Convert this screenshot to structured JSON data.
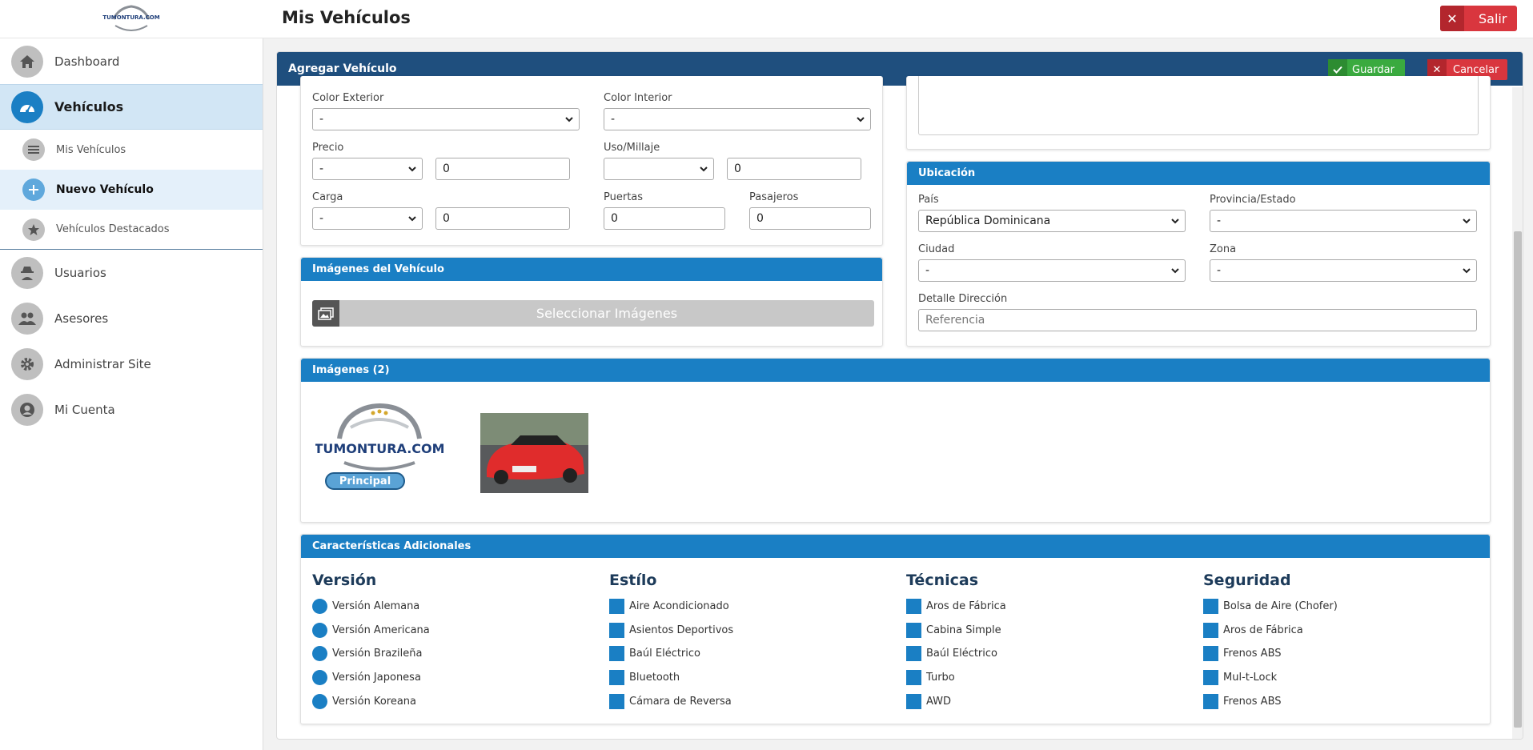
{
  "header": {
    "title": "Mis Vehículos",
    "logout_label": "Salir",
    "logo_text": "TUMONTURA.COM"
  },
  "sidebar": {
    "items": [
      {
        "label": "Dashboard",
        "icon": "home-icon"
      },
      {
        "label": "Vehículos",
        "icon": "speedometer-icon"
      },
      {
        "label": "Usuarios",
        "icon": "spy-icon"
      },
      {
        "label": "Asesores",
        "icon": "users-icon"
      },
      {
        "label": "Administrar Site",
        "icon": "gear-icon"
      },
      {
        "label": "Mi Cuenta",
        "icon": "user-circle-icon"
      }
    ],
    "subitems": [
      {
        "label": "Mis Vehículos",
        "icon": "list-icon"
      },
      {
        "label": "Nuevo Vehículo",
        "icon": "plus-icon"
      },
      {
        "label": "Vehículos Destacados",
        "icon": "star-icon"
      }
    ]
  },
  "form": {
    "title": "Agregar Vehículo",
    "save_label": "Guardar",
    "cancel_label": "Cancelar",
    "color_exterior": {
      "label": "Color Exterior",
      "value": "-"
    },
    "color_interior": {
      "label": "Color Interior",
      "value": "-"
    },
    "precio": {
      "label": "Precio",
      "currency": "-",
      "value": "0"
    },
    "uso": {
      "label": "Uso/Millaje",
      "unit": "",
      "value": "0"
    },
    "carga": {
      "label": "Carga",
      "unit": "-",
      "value": "0"
    },
    "puertas": {
      "label": "Puertas",
      "value": "0"
    },
    "pasajeros": {
      "label": "Pasajeros",
      "value": "0"
    }
  },
  "ubicacion": {
    "title": "Ubicación",
    "pais": {
      "label": "País",
      "value": "República Dominicana"
    },
    "provincia": {
      "label": "Provincia/Estado",
      "value": "-"
    },
    "ciudad": {
      "label": "Ciudad",
      "value": "-"
    },
    "zona": {
      "label": "Zona",
      "value": "-"
    },
    "detalle": {
      "label": "Detalle Dirección",
      "placeholder": "Referencia"
    }
  },
  "imagenes_vehiculo": {
    "title": "Imágenes del Vehículo",
    "select_label": "Seleccionar Imágenes"
  },
  "imagenes": {
    "title": "Imágenes (2)",
    "principal_label": "Principal",
    "logo_text": "TUMONTURA.COM"
  },
  "caracteristicas": {
    "title": "Características Adicionales",
    "groups": [
      {
        "title": "Versión",
        "shape": "circle",
        "items": [
          "Versión Alemana",
          "Versión Americana",
          "Versión Brazileña",
          "Versión Japonesa",
          "Versión Koreana"
        ]
      },
      {
        "title": "Estílo",
        "shape": "square",
        "items": [
          "Aire Acondicionado",
          "Asientos Deportivos",
          "Baúl Eléctrico",
          "Bluetooth",
          "Cámara de Reversa"
        ]
      },
      {
        "title": "Técnicas",
        "shape": "square",
        "items": [
          "Aros de Fábrica",
          "Cabina Simple",
          "Baúl Eléctrico",
          "Turbo",
          "AWD"
        ]
      },
      {
        "title": "Seguridad",
        "shape": "square",
        "items": [
          "Bolsa de Aire (Chofer)",
          "Aros de Fábrica",
          "Frenos ABS",
          "Mul-t-Lock",
          "Frenos ABS"
        ]
      }
    ]
  },
  "colors": {
    "header_dark": "#1f4f7e",
    "accent": "#1a7fc4",
    "save": "#3aaa3f",
    "danger": "#d9363e"
  }
}
